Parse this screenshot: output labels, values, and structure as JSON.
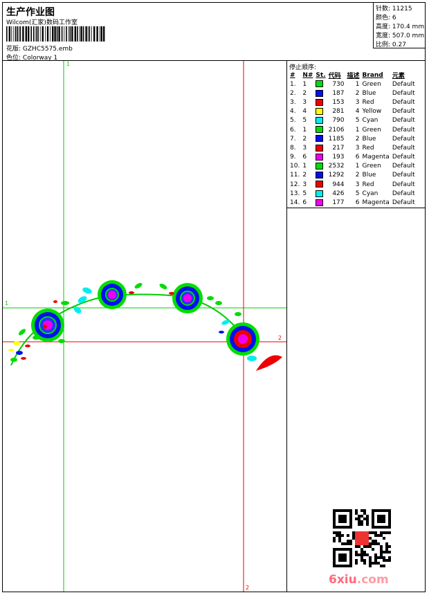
{
  "header": {
    "title": "生产作业图",
    "company": "Wilcom(汇家)数码工作室",
    "file_label": "花版:",
    "file_value": "GZHC5575.emb",
    "colorway_label": "色位:",
    "colorway_value": "Colorway 1"
  },
  "stats": {
    "stitches_label": "针数:",
    "stitches_value": "11215",
    "colors_label": "颜色:",
    "colors_value": "6",
    "height_label": "高度:",
    "height_value": "170.4 mm",
    "width_label": "宽度:",
    "width_value": "507.0 mm",
    "scale_label": "比例:",
    "scale_value": "0.27"
  },
  "stop_sequence": {
    "title": "停止顺序:",
    "columns": [
      "#",
      "N#",
      "St.",
      "代码",
      "描述",
      "Brand",
      "元素"
    ],
    "rows": [
      {
        "idx": "1.",
        "n": "1",
        "st": "730",
        "code": "1",
        "color": "#00dd00",
        "desc": "Green",
        "brand": "Default"
      },
      {
        "idx": "2.",
        "n": "2",
        "st": "187",
        "code": "2",
        "color": "#0010ee",
        "desc": "Blue",
        "brand": "Default"
      },
      {
        "idx": "3.",
        "n": "3",
        "st": "153",
        "code": "3",
        "color": "#ee0000",
        "desc": "Red",
        "brand": "Default"
      },
      {
        "idx": "4.",
        "n": "4",
        "st": "281",
        "code": "4",
        "color": "#ffff00",
        "desc": "Yellow",
        "brand": "Default"
      },
      {
        "idx": "5.",
        "n": "5",
        "st": "790",
        "code": "5",
        "color": "#00eeee",
        "desc": "Cyan",
        "brand": "Default"
      },
      {
        "idx": "6.",
        "n": "1",
        "st": "2106",
        "code": "1",
        "color": "#00dd00",
        "desc": "Green",
        "brand": "Default"
      },
      {
        "idx": "7.",
        "n": "2",
        "st": "1185",
        "code": "2",
        "color": "#0010ee",
        "desc": "Blue",
        "brand": "Default"
      },
      {
        "idx": "8.",
        "n": "3",
        "st": "217",
        "code": "3",
        "color": "#ee0000",
        "desc": "Red",
        "brand": "Default"
      },
      {
        "idx": "9.",
        "n": "6",
        "st": "193",
        "code": "6",
        "color": "#ee00ee",
        "desc": "Magenta",
        "brand": "Default"
      },
      {
        "idx": "10.",
        "n": "1",
        "st": "2532",
        "code": "1",
        "color": "#00dd00",
        "desc": "Green",
        "brand": "Default"
      },
      {
        "idx": "11.",
        "n": "2",
        "st": "1292",
        "code": "2",
        "color": "#0010ee",
        "desc": "Blue",
        "brand": "Default"
      },
      {
        "idx": "12.",
        "n": "3",
        "st": "944",
        "code": "3",
        "color": "#ee0000",
        "desc": "Red",
        "brand": "Default"
      },
      {
        "idx": "13.",
        "n": "5",
        "st": "426",
        "code": "5",
        "color": "#00eeee",
        "desc": "Cyan",
        "brand": "Default"
      },
      {
        "idx": "14.",
        "n": "6",
        "st": "177",
        "code": "6",
        "color": "#ee00ee",
        "desc": "Magenta",
        "brand": "Default"
      }
    ]
  },
  "canvas": {
    "guide_green_label_top": "1",
    "guide_green_label_left": "1",
    "guide_red_label_right": "2",
    "guide_red_label_bottom": "2",
    "guide_green_color": "#00cc00",
    "guide_red_color": "#ee0000"
  },
  "watermark": {
    "part_a": "6xiu",
    "part_b": ".com"
  }
}
